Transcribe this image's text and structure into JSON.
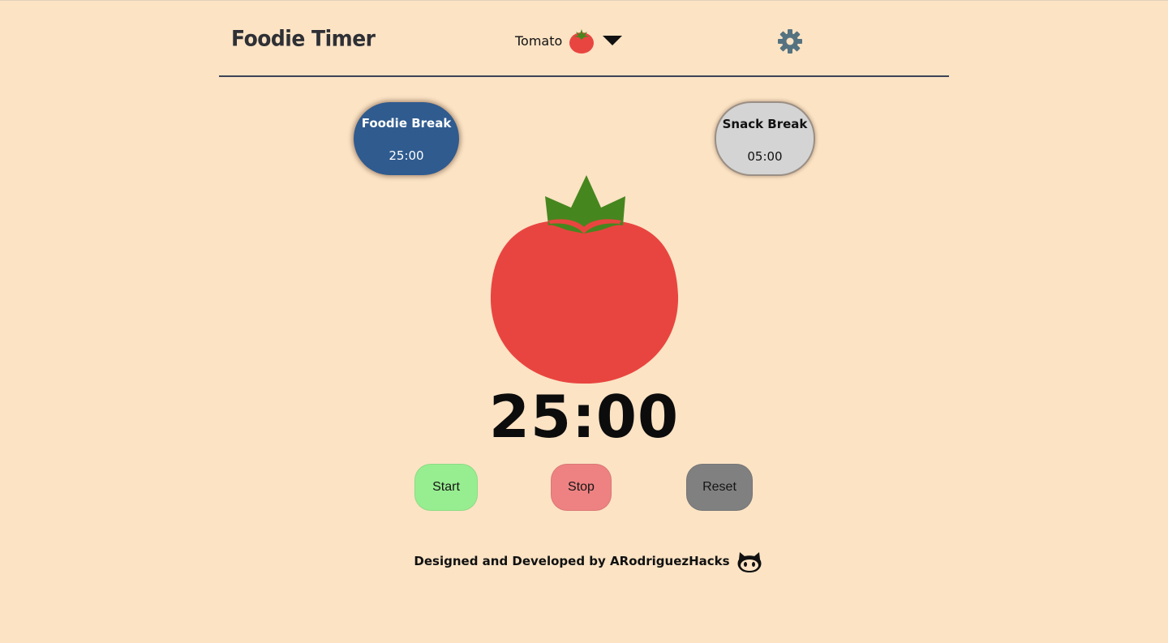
{
  "app": {
    "title": "Foodie Timer"
  },
  "header": {
    "food_select": {
      "selected": "Tomato",
      "icon": "tomato-icon"
    },
    "settings_icon": "gear-icon"
  },
  "modes": [
    {
      "name": "Foodie Break",
      "time": "25:00",
      "active": true,
      "color": "#2f5b8f"
    },
    {
      "name": "Snack Break",
      "time": "05:00",
      "active": false,
      "color": "#d4d4d4"
    }
  ],
  "timer": {
    "display": "25:00"
  },
  "controls": {
    "start_label": "Start",
    "stop_label": "Stop",
    "reset_label": "Reset",
    "start_color": "#97ee90",
    "stop_color": "#ee8282",
    "reset_color": "#808080"
  },
  "footer": {
    "credit": "Designed and Developed by ARodriguezHacks",
    "github_icon": "github-icon"
  },
  "colors": {
    "background": "#fbe3c4",
    "tomato_red": "#e94540",
    "leaf_green": "#46861e"
  }
}
